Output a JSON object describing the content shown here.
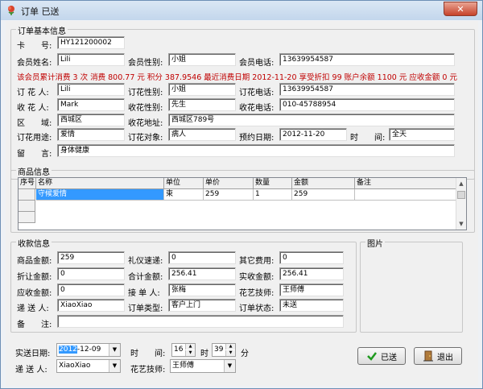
{
  "window": {
    "title": "订单 已送",
    "close_glyph": "✕"
  },
  "basic": {
    "group_title": "订单基本信息",
    "card_label": "卡　　号:",
    "card_no": "HY121200002",
    "member_name_label": "会员姓名:",
    "member_name": "Lili",
    "member_gender_label": "会员性别:",
    "member_gender": "小姐",
    "member_phone_label": "会员电话:",
    "member_phone": "13639954587",
    "notice": "该会员累计消费 3 次 消费 800.77 元 积分 387.9546 最近消费日期 2012-11-20 享受折扣 99 账户余额 1100 元 应收金额 0 元",
    "orderer_label": "订 花 人:",
    "orderer": "Lili",
    "orderer_gender_label": "订花性别:",
    "orderer_gender": "小姐",
    "orderer_phone_label": "订花电话:",
    "orderer_phone": "13639954587",
    "receiver_label": "收 花 人:",
    "receiver": "Mark",
    "receiver_gender_label": "收花性别:",
    "receiver_gender": "先生",
    "receiver_phone_label": "收花电话:",
    "receiver_phone": "010-45788954",
    "district_label": "区　　域:",
    "district": "西城区",
    "address_label": "收花地址:",
    "address": "西城区789号",
    "purpose_label": "订花用途:",
    "purpose": "爱情",
    "target_label": "订花对象:",
    "target": "病人",
    "reserve_date_label": "预约日期:",
    "reserve_date": "2012-11-20",
    "time_label": "时　　间:",
    "time": "全天",
    "message_label": "留　　言:",
    "message": "身体健康"
  },
  "goods": {
    "group_title": "商品信息",
    "columns": [
      "序号",
      "名称",
      "单位",
      "单价",
      "数量",
      "金额",
      "备注"
    ],
    "rows": [
      {
        "name": "守候爱情",
        "unit": "束",
        "price": "259",
        "qty": "1",
        "amount": "259",
        "note": ""
      }
    ]
  },
  "payment": {
    "group_title": "收款信息",
    "goods_amount_label": "商品金额:",
    "goods_amount": "259",
    "gift_fee_label": "礼仪速递:",
    "gift_fee": "0",
    "other_fee_label": "其它费用:",
    "other_fee": "0",
    "discount_label": "折让金额:",
    "discount": "0",
    "total_label": "合计金额:",
    "total": "256.41",
    "received_label": "实收金额:",
    "received": "256.41",
    "receivable_label": "应收金额:",
    "receivable": "0",
    "handler_label": "接 单 人:",
    "handler": "张梅",
    "florist_label": "花艺技师:",
    "florist": "王师傅",
    "courier_label": "递 送 人:",
    "courier": "XiaoXiao",
    "order_type_label": "订单类型:",
    "order_type": "客户上门",
    "order_status_label": "订单状态:",
    "order_status": "未送",
    "remark_label": "备　　注:",
    "remark": ""
  },
  "picture": {
    "group_title": "图片"
  },
  "delivery": {
    "date_label": "实送日期:",
    "date_year_sel": "2012",
    "date_rest": "-12-09",
    "time_label": "时　　间:",
    "hour": "16",
    "hour_suffix": "时",
    "minute": "39",
    "minute_suffix": "分",
    "courier_label": "递 送 人:",
    "courier": "XiaoXiao",
    "florist_label": "花艺技师:",
    "florist": "王师傅"
  },
  "buttons": {
    "sent": "已送",
    "exit": "退出"
  },
  "colors": {
    "notice": "#c00000",
    "selection": "#3399ff",
    "close": "#c7432b"
  }
}
